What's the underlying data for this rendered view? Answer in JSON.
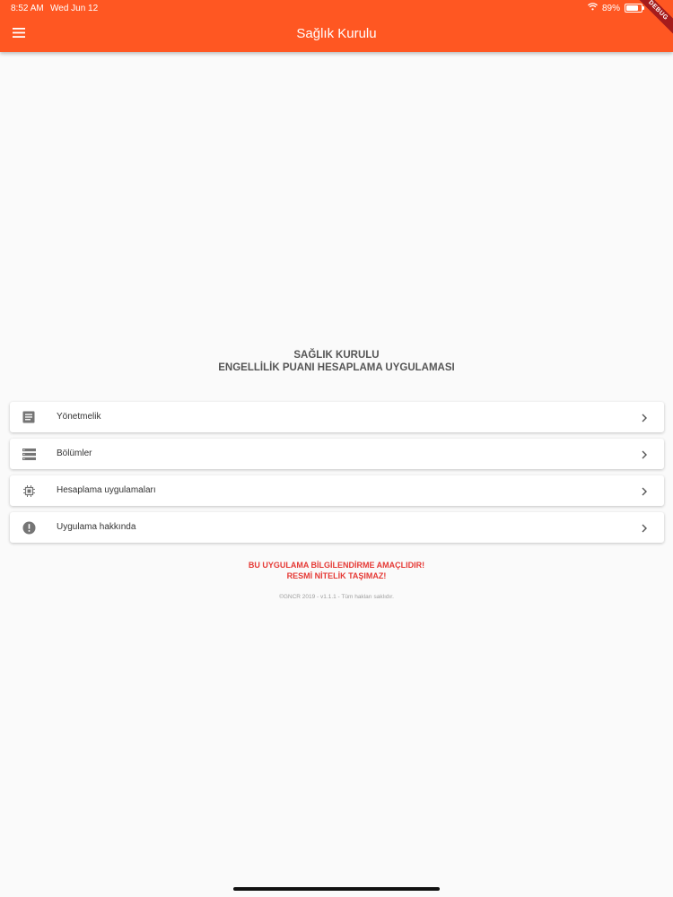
{
  "status": {
    "time": "8:52 AM",
    "date": "Wed Jun 12",
    "battery": "89%"
  },
  "appbar": {
    "title": "Sağlık Kurulu",
    "debug_banner": "DEBUG",
    "color": "#ff5722"
  },
  "heading": {
    "line1": "SAĞLIK KURULU",
    "line2": "ENGELLİLİK PUANI HESAPLAMA UYGULAMASI"
  },
  "menu": {
    "items": [
      {
        "label": "Yönetmelik",
        "icon": "document-icon"
      },
      {
        "label": "Bölümler",
        "icon": "list-icon"
      },
      {
        "label": "Hesaplama uygulamaları",
        "icon": "chip-icon"
      },
      {
        "label": "Uygulama hakkında",
        "icon": "info-icon"
      }
    ]
  },
  "warning": {
    "line1": "BU UYGULAMA BİLGİLENDİRME AMAÇLIDIR!",
    "line2": "RESMİ NİTELİK TAŞIMAZ!",
    "color": "#e53935"
  },
  "footer": {
    "text": "©GNCR 2019 - v1.1.1 - Tüm hakları saklıdır."
  }
}
